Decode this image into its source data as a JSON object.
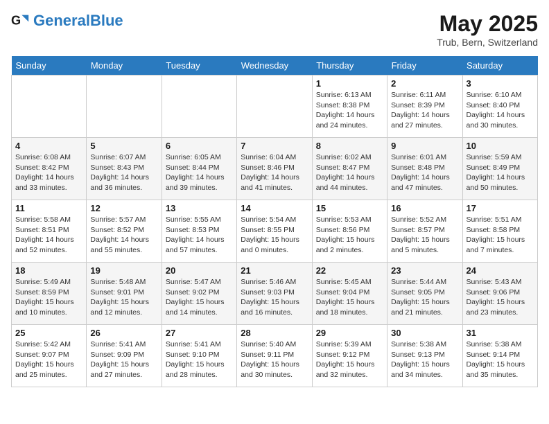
{
  "header": {
    "logo_general": "General",
    "logo_blue": "Blue",
    "title": "May 2025",
    "subtitle": "Trub, Bern, Switzerland"
  },
  "weekdays": [
    "Sunday",
    "Monday",
    "Tuesday",
    "Wednesday",
    "Thursday",
    "Friday",
    "Saturday"
  ],
  "weeks": [
    [
      {
        "day": "",
        "sunrise": "",
        "sunset": "",
        "daylight": ""
      },
      {
        "day": "",
        "sunrise": "",
        "sunset": "",
        "daylight": ""
      },
      {
        "day": "",
        "sunrise": "",
        "sunset": "",
        "daylight": ""
      },
      {
        "day": "",
        "sunrise": "",
        "sunset": "",
        "daylight": ""
      },
      {
        "day": "1",
        "sunrise": "Sunrise: 6:13 AM",
        "sunset": "Sunset: 8:38 PM",
        "daylight": "Daylight: 14 hours and 24 minutes."
      },
      {
        "day": "2",
        "sunrise": "Sunrise: 6:11 AM",
        "sunset": "Sunset: 8:39 PM",
        "daylight": "Daylight: 14 hours and 27 minutes."
      },
      {
        "day": "3",
        "sunrise": "Sunrise: 6:10 AM",
        "sunset": "Sunset: 8:40 PM",
        "daylight": "Daylight: 14 hours and 30 minutes."
      }
    ],
    [
      {
        "day": "4",
        "sunrise": "Sunrise: 6:08 AM",
        "sunset": "Sunset: 8:42 PM",
        "daylight": "Daylight: 14 hours and 33 minutes."
      },
      {
        "day": "5",
        "sunrise": "Sunrise: 6:07 AM",
        "sunset": "Sunset: 8:43 PM",
        "daylight": "Daylight: 14 hours and 36 minutes."
      },
      {
        "day": "6",
        "sunrise": "Sunrise: 6:05 AM",
        "sunset": "Sunset: 8:44 PM",
        "daylight": "Daylight: 14 hours and 39 minutes."
      },
      {
        "day": "7",
        "sunrise": "Sunrise: 6:04 AM",
        "sunset": "Sunset: 8:46 PM",
        "daylight": "Daylight: 14 hours and 41 minutes."
      },
      {
        "day": "8",
        "sunrise": "Sunrise: 6:02 AM",
        "sunset": "Sunset: 8:47 PM",
        "daylight": "Daylight: 14 hours and 44 minutes."
      },
      {
        "day": "9",
        "sunrise": "Sunrise: 6:01 AM",
        "sunset": "Sunset: 8:48 PM",
        "daylight": "Daylight: 14 hours and 47 minutes."
      },
      {
        "day": "10",
        "sunrise": "Sunrise: 5:59 AM",
        "sunset": "Sunset: 8:49 PM",
        "daylight": "Daylight: 14 hours and 50 minutes."
      }
    ],
    [
      {
        "day": "11",
        "sunrise": "Sunrise: 5:58 AM",
        "sunset": "Sunset: 8:51 PM",
        "daylight": "Daylight: 14 hours and 52 minutes."
      },
      {
        "day": "12",
        "sunrise": "Sunrise: 5:57 AM",
        "sunset": "Sunset: 8:52 PM",
        "daylight": "Daylight: 14 hours and 55 minutes."
      },
      {
        "day": "13",
        "sunrise": "Sunrise: 5:55 AM",
        "sunset": "Sunset: 8:53 PM",
        "daylight": "Daylight: 14 hours and 57 minutes."
      },
      {
        "day": "14",
        "sunrise": "Sunrise: 5:54 AM",
        "sunset": "Sunset: 8:55 PM",
        "daylight": "Daylight: 15 hours and 0 minutes."
      },
      {
        "day": "15",
        "sunrise": "Sunrise: 5:53 AM",
        "sunset": "Sunset: 8:56 PM",
        "daylight": "Daylight: 15 hours and 2 minutes."
      },
      {
        "day": "16",
        "sunrise": "Sunrise: 5:52 AM",
        "sunset": "Sunset: 8:57 PM",
        "daylight": "Daylight: 15 hours and 5 minutes."
      },
      {
        "day": "17",
        "sunrise": "Sunrise: 5:51 AM",
        "sunset": "Sunset: 8:58 PM",
        "daylight": "Daylight: 15 hours and 7 minutes."
      }
    ],
    [
      {
        "day": "18",
        "sunrise": "Sunrise: 5:49 AM",
        "sunset": "Sunset: 8:59 PM",
        "daylight": "Daylight: 15 hours and 10 minutes."
      },
      {
        "day": "19",
        "sunrise": "Sunrise: 5:48 AM",
        "sunset": "Sunset: 9:01 PM",
        "daylight": "Daylight: 15 hours and 12 minutes."
      },
      {
        "day": "20",
        "sunrise": "Sunrise: 5:47 AM",
        "sunset": "Sunset: 9:02 PM",
        "daylight": "Daylight: 15 hours and 14 minutes."
      },
      {
        "day": "21",
        "sunrise": "Sunrise: 5:46 AM",
        "sunset": "Sunset: 9:03 PM",
        "daylight": "Daylight: 15 hours and 16 minutes."
      },
      {
        "day": "22",
        "sunrise": "Sunrise: 5:45 AM",
        "sunset": "Sunset: 9:04 PM",
        "daylight": "Daylight: 15 hours and 18 minutes."
      },
      {
        "day": "23",
        "sunrise": "Sunrise: 5:44 AM",
        "sunset": "Sunset: 9:05 PM",
        "daylight": "Daylight: 15 hours and 21 minutes."
      },
      {
        "day": "24",
        "sunrise": "Sunrise: 5:43 AM",
        "sunset": "Sunset: 9:06 PM",
        "daylight": "Daylight: 15 hours and 23 minutes."
      }
    ],
    [
      {
        "day": "25",
        "sunrise": "Sunrise: 5:42 AM",
        "sunset": "Sunset: 9:07 PM",
        "daylight": "Daylight: 15 hours and 25 minutes."
      },
      {
        "day": "26",
        "sunrise": "Sunrise: 5:41 AM",
        "sunset": "Sunset: 9:09 PM",
        "daylight": "Daylight: 15 hours and 27 minutes."
      },
      {
        "day": "27",
        "sunrise": "Sunrise: 5:41 AM",
        "sunset": "Sunset: 9:10 PM",
        "daylight": "Daylight: 15 hours and 28 minutes."
      },
      {
        "day": "28",
        "sunrise": "Sunrise: 5:40 AM",
        "sunset": "Sunset: 9:11 PM",
        "daylight": "Daylight: 15 hours and 30 minutes."
      },
      {
        "day": "29",
        "sunrise": "Sunrise: 5:39 AM",
        "sunset": "Sunset: 9:12 PM",
        "daylight": "Daylight: 15 hours and 32 minutes."
      },
      {
        "day": "30",
        "sunrise": "Sunrise: 5:38 AM",
        "sunset": "Sunset: 9:13 PM",
        "daylight": "Daylight: 15 hours and 34 minutes."
      },
      {
        "day": "31",
        "sunrise": "Sunrise: 5:38 AM",
        "sunset": "Sunset: 9:14 PM",
        "daylight": "Daylight: 15 hours and 35 minutes."
      }
    ]
  ]
}
